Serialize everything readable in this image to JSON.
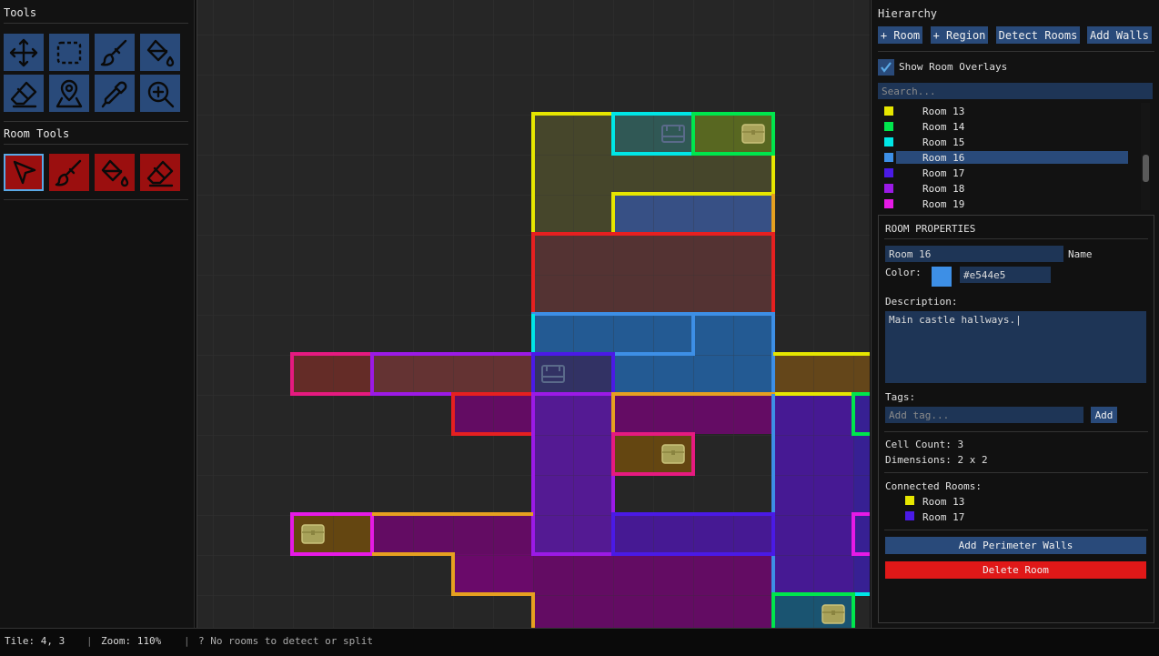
{
  "tools": {
    "title": "Tools",
    "room_tools_title": "Room Tools",
    "main_tools": [
      {
        "name": "move-tool",
        "icon": "move-icon"
      },
      {
        "name": "select-tool",
        "icon": "marquee-select-icon"
      },
      {
        "name": "brush-tool",
        "icon": "brush-icon"
      },
      {
        "name": "fill-tool",
        "icon": "paint-bucket-icon"
      },
      {
        "name": "eraser-tool",
        "icon": "eraser-icon"
      },
      {
        "name": "location-tool",
        "icon": "map-pin-icon"
      },
      {
        "name": "eyedropper-tool",
        "icon": "eyedropper-icon"
      },
      {
        "name": "zoom-tool",
        "icon": "zoom-in-icon"
      }
    ],
    "room_tools": [
      {
        "name": "room-select-tool",
        "icon": "pointer-icon",
        "active": true
      },
      {
        "name": "room-brush-tool",
        "icon": "brush-icon"
      },
      {
        "name": "room-fill-tool",
        "icon": "paint-bucket-icon"
      },
      {
        "name": "room-eraser-tool",
        "icon": "eraser-icon"
      }
    ],
    "colors": {
      "tool_blue": "#294a7a",
      "tool_red": "#9b0f0f",
      "active_outline": "#5aa9e6"
    }
  },
  "hierarchy": {
    "title": "Hierarchy",
    "buttons": [
      "+ Room",
      "+ Region",
      "Detect Rooms",
      "Add Walls"
    ],
    "show_overlays_label": "Show Room Overlays",
    "show_overlays_checked": true,
    "search_placeholder": "Search...",
    "rooms": [
      {
        "label": "Room 13",
        "color": "#e6e600"
      },
      {
        "label": "Room 14",
        "color": "#00e64d"
      },
      {
        "label": "Room 15",
        "color": "#00e6e6"
      },
      {
        "label": "Room 16",
        "color": "#3d8fe6",
        "selected": true
      },
      {
        "label": "Room 17",
        "color": "#4a1ae6"
      },
      {
        "label": "Room 18",
        "color": "#9b1ae6"
      },
      {
        "label": "Room 19",
        "color": "#e61ae6"
      }
    ]
  },
  "properties": {
    "title": "ROOM PROPERTIES",
    "name_value": "Room 16",
    "name_label": "Name",
    "color_label": "Color:",
    "color_swatch": "#3d8fe6",
    "color_hex": "#e544e5",
    "description_label": "Description:",
    "description_value": "Main castle hallways.|",
    "tags_label": "Tags:",
    "tag_placeholder": "Add tag...",
    "add_tag_label": "Add",
    "cell_count": "Cell Count: 3",
    "dimensions": "Dimensions: 2 x 2",
    "connected_label": "Connected Rooms:",
    "connected": [
      {
        "label": "Room 13",
        "color": "#e6e600"
      },
      {
        "label": "Room 17",
        "color": "#4a1ae6"
      }
    ],
    "add_walls_label": "Add Perimeter Walls",
    "delete_label": "Delete Room",
    "colors": {
      "delete": "#e01818",
      "add_walls": "#294a7a"
    }
  },
  "status": {
    "tile": "Tile: 4, 3",
    "zoom": "Zoom: 110%",
    "message": "? No rooms to detect or split"
  }
}
